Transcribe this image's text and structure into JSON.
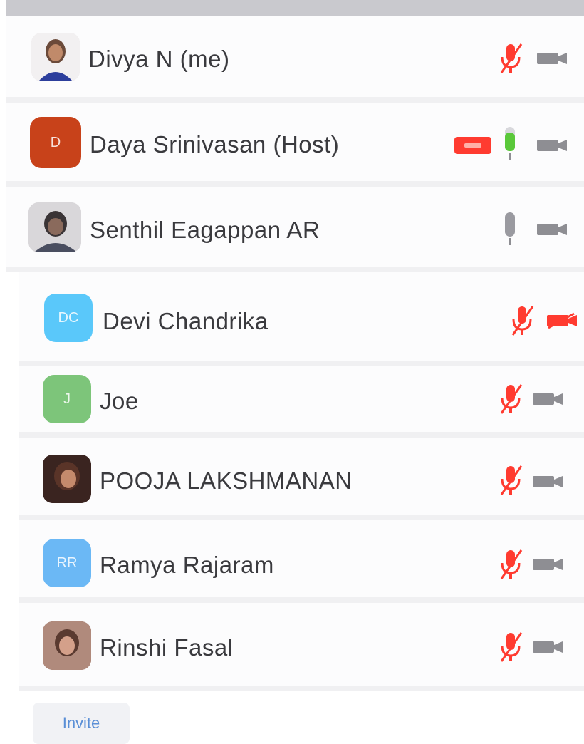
{
  "participants": [
    {
      "name": "Divya N (me)",
      "avatar_type": "photo",
      "initials": "",
      "avatar_color": "#6b4a3a",
      "mic": "muted",
      "video": "off"
    },
    {
      "name": "Daya Srinivasan (Host)",
      "avatar_type": "initials",
      "initials": "D",
      "avatar_color": "#c8421a",
      "mic": "speaking",
      "video": "off",
      "cc": true
    },
    {
      "name": "Senthil Eagappan AR",
      "avatar_type": "photo",
      "initials": "",
      "avatar_color": "#5a5560",
      "mic": "on",
      "video": "off"
    },
    {
      "name": "Devi Chandrika",
      "avatar_type": "initials",
      "initials": "DC",
      "avatar_color": "#5ac8fa",
      "mic": "muted",
      "video": "muted"
    },
    {
      "name": "Joe",
      "avatar_type": "initials",
      "initials": "J",
      "avatar_color": "#7dc57a",
      "mic": "muted",
      "video": "off"
    },
    {
      "name": "POOJA LAKSHMANAN",
      "avatar_type": "photo",
      "initials": "",
      "avatar_color": "#4a2e28",
      "mic": "muted",
      "video": "off"
    },
    {
      "name": "Ramya Rajaram",
      "avatar_type": "initials",
      "initials": "RR",
      "avatar_color": "#6bb8f5",
      "mic": "muted",
      "video": "off"
    },
    {
      "name": "Rinshi Fasal",
      "avatar_type": "photo",
      "initials": "",
      "avatar_color": "#8a5a4a",
      "mic": "muted",
      "video": "off"
    }
  ],
  "invite_label": "Invite",
  "colors": {
    "muted_red": "#ff3b30",
    "speaking_green": "#5ac83a",
    "icon_gray": "#8e8e93"
  }
}
